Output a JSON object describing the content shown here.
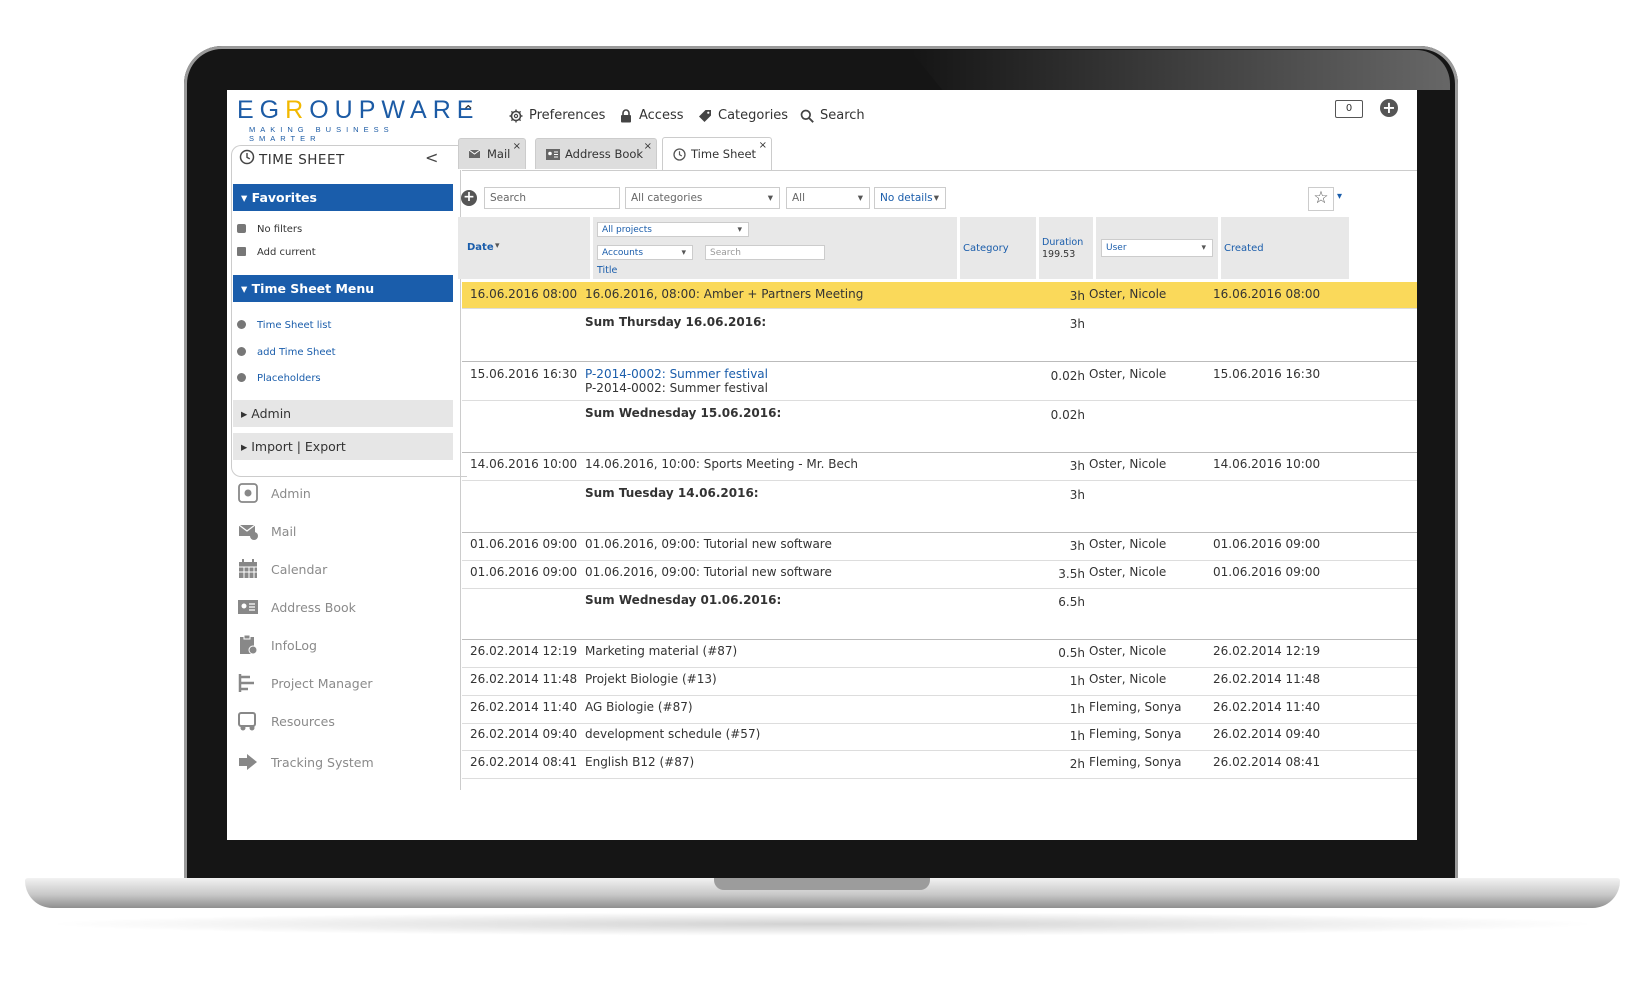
{
  "header": {
    "logo_main_1": "EG",
    "logo_main_o": "R",
    "logo_main_2": "OUPWARE",
    "logo_sub": "MAKING BUSINESS SMARTER",
    "nav": [
      {
        "label": "Preferences",
        "icon": "gear-icon"
      },
      {
        "label": "Access",
        "icon": "lock-icon"
      },
      {
        "label": "Categories",
        "icon": "tag-icon"
      },
      {
        "label": "Search",
        "icon": "search-icon"
      }
    ],
    "notification_count": "0"
  },
  "sidebar": {
    "title": "TIME SHEET",
    "favorites_label": "Favorites",
    "favorites": [
      "No filters",
      "Add current"
    ],
    "menu_label": "Time Sheet Menu",
    "menu_items": [
      "Time Sheet list",
      "add Time Sheet",
      "Placeholders"
    ],
    "folds": [
      "Admin",
      "Import | Export"
    ],
    "apps": [
      "Admin",
      "Mail",
      "Calendar",
      "Address Book",
      "InfoLog",
      "Project Manager",
      "Resources",
      "Tracking System"
    ]
  },
  "tabs": [
    {
      "label": "Mail",
      "active": false
    },
    {
      "label": "Address Book",
      "active": false
    },
    {
      "label": "Time Sheet",
      "active": true
    }
  ],
  "toolbar": {
    "search_placeholder": "Search",
    "category": "All categories",
    "status": "All",
    "details": "No details"
  },
  "columns": {
    "date": "Date",
    "projects": "All projects",
    "accounts": "Accounts",
    "search": "Search",
    "title": "Title",
    "category": "Category",
    "duration": "Duration",
    "duration_total": "199.53",
    "user": "User",
    "created": "Created"
  },
  "rows": [
    {
      "date": "16.06.2016 08:00",
      "title": "16.06.2016, 08:00: Amber + Partners Meeting",
      "duration": "3h",
      "user": "Oster, Nicole",
      "created": "16.06.2016 08:00"
    },
    {
      "sum": "Sum Thursday 16.06.2016:",
      "duration": "3h"
    },
    {
      "date": "15.06.2016 16:30",
      "title": "P-2014-0002: Summer festival",
      "title2": "P-2014-0002: Summer festival",
      "duration": "0.02h",
      "user": "Oster, Nicole",
      "created": "15.06.2016 16:30"
    },
    {
      "sum": "Sum Wednesday 15.06.2016:",
      "duration": "0.02h"
    },
    {
      "date": "14.06.2016 10:00",
      "title": "14.06.2016, 10:00: Sports Meeting - Mr. Bech",
      "duration": "3h",
      "user": "Oster, Nicole",
      "created": "14.06.2016 10:00"
    },
    {
      "sum": "Sum Tuesday 14.06.2016:",
      "duration": "3h"
    },
    {
      "date": "01.06.2016 09:00",
      "title": "01.06.2016, 09:00: Tutorial new software",
      "duration": "3h",
      "user": "Oster, Nicole",
      "created": "01.06.2016 09:00"
    },
    {
      "date": "01.06.2016 09:00",
      "title": "01.06.2016, 09:00: Tutorial new software",
      "duration": "3.5h",
      "user": "Oster, Nicole",
      "created": "01.06.2016 09:00"
    },
    {
      "sum": "Sum Wednesday 01.06.2016:",
      "duration": "6.5h"
    },
    {
      "date": "26.02.2014 12:19",
      "title": "Marketing material (#87)",
      "duration": "0.5h",
      "user": "Oster, Nicole",
      "created": "26.02.2014 12:19"
    },
    {
      "date": "26.02.2014 11:48",
      "title": "Projekt Biologie (#13)",
      "duration": "1h",
      "user": "Oster, Nicole",
      "created": "26.02.2014 11:48"
    },
    {
      "date": "26.02.2014 11:40",
      "title": "AG Biologie (#87)",
      "duration": "1h",
      "user": "Fleming, Sonya",
      "created": "26.02.2014 11:40"
    },
    {
      "date": "26.02.2014 09:40",
      "title": "development schedule (#57)",
      "duration": "1h",
      "user": "Fleming, Sonya",
      "created": "26.02.2014 09:40"
    },
    {
      "date": "26.02.2014 08:41",
      "title": "English B12 (#87)",
      "duration": "2h",
      "user": "Fleming, Sonya",
      "created": "26.02.2014 08:41"
    }
  ],
  "colors": {
    "accent": "#1a5dab",
    "highlight": "#fad95a",
    "logo_yellow": "#f2b800"
  }
}
